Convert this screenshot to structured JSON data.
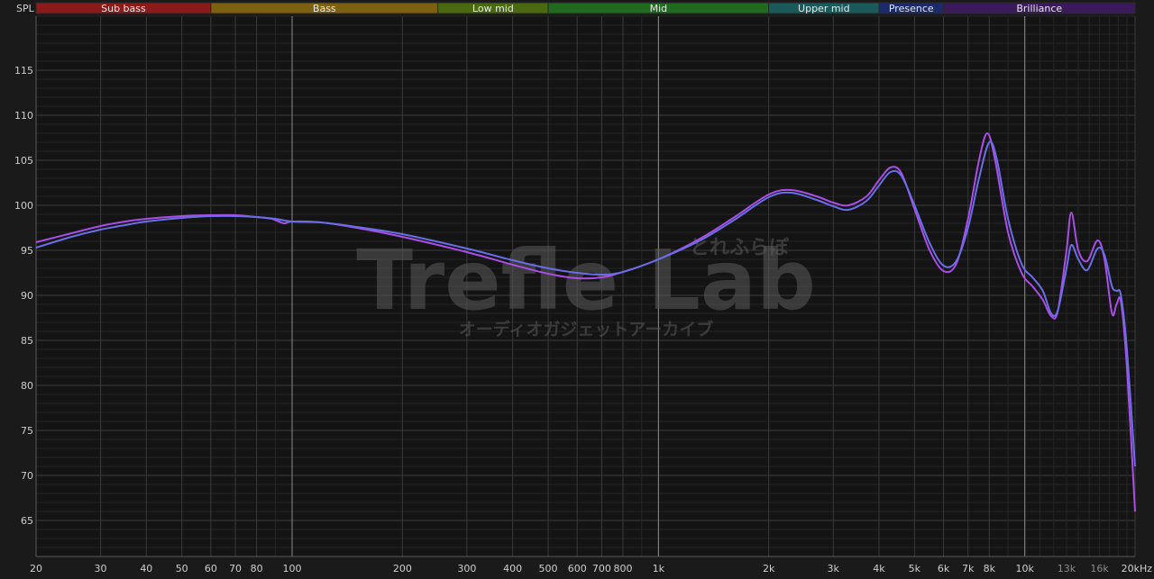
{
  "chart_data": {
    "type": "line",
    "ylabel": "SPL",
    "xscale": "log",
    "xlim": [
      20,
      20000
    ],
    "ylim": [
      61,
      121
    ],
    "yticks": [
      65,
      70,
      75,
      80,
      85,
      90,
      95,
      100,
      105,
      110,
      115
    ],
    "xticks": [
      {
        "v": 20,
        "label": "20"
      },
      {
        "v": 30,
        "label": "30"
      },
      {
        "v": 40,
        "label": "40"
      },
      {
        "v": 50,
        "label": "50"
      },
      {
        "v": 60,
        "label": "60"
      },
      {
        "v": 70,
        "label": "70"
      },
      {
        "v": 80,
        "label": "80"
      },
      {
        "v": 100,
        "label": "100"
      },
      {
        "v": 200,
        "label": "200"
      },
      {
        "v": 300,
        "label": "300"
      },
      {
        "v": 400,
        "label": "400"
      },
      {
        "v": 500,
        "label": "500"
      },
      {
        "v": 600,
        "label": "600"
      },
      {
        "v": 700,
        "label": "700"
      },
      {
        "v": 800,
        "label": "800"
      },
      {
        "v": 1000,
        "label": "1k"
      },
      {
        "v": 2000,
        "label": "2k"
      },
      {
        "v": 3000,
        "label": "3k"
      },
      {
        "v": 4000,
        "label": "4k"
      },
      {
        "v": 5000,
        "label": "5k"
      },
      {
        "v": 6000,
        "label": "6k"
      },
      {
        "v": 7000,
        "label": "7k"
      },
      {
        "v": 8000,
        "label": "8k"
      },
      {
        "v": 10000,
        "label": "10k"
      },
      {
        "v": 13000,
        "label": "13k",
        "dim": true
      },
      {
        "v": 16000,
        "label": "16k",
        "dim": true
      },
      {
        "v": 20000,
        "label": "20kHz"
      }
    ],
    "grid": true,
    "bands": [
      {
        "label": "Sub bass",
        "from": 20,
        "to": 60,
        "color": "#8b1a1a"
      },
      {
        "label": "Bass",
        "from": 60,
        "to": 250,
        "color": "#7d6010"
      },
      {
        "label": "Low mid",
        "from": 250,
        "to": 500,
        "color": "#4a6a10"
      },
      {
        "label": "Mid",
        "from": 500,
        "to": 2000,
        "color": "#1f6a1f"
      },
      {
        "label": "Upper mid",
        "from": 2000,
        "to": 4000,
        "color": "#1a5a5a"
      },
      {
        "label": "Presence",
        "from": 4000,
        "to": 6000,
        "color": "#1a2a6a"
      },
      {
        "label": "Brilliance",
        "from": 6000,
        "to": 20000,
        "color": "#3a1a5a"
      }
    ],
    "series": [
      {
        "color": "#a94ee6",
        "points": [
          [
            20,
            95.9
          ],
          [
            25,
            96.9
          ],
          [
            30,
            97.7
          ],
          [
            35,
            98.2
          ],
          [
            40,
            98.5
          ],
          [
            50,
            98.8
          ],
          [
            60,
            98.9
          ],
          [
            70,
            98.9
          ],
          [
            80,
            98.7
          ],
          [
            88,
            98.5
          ],
          [
            95,
            98.0
          ],
          [
            100,
            98.2
          ],
          [
            120,
            98.1
          ],
          [
            150,
            97.5
          ],
          [
            200,
            96.5
          ],
          [
            300,
            94.8
          ],
          [
            400,
            93.4
          ],
          [
            500,
            92.4
          ],
          [
            600,
            91.9
          ],
          [
            700,
            92.0
          ],
          [
            800,
            92.6
          ],
          [
            1000,
            94.0
          ],
          [
            1300,
            96.3
          ],
          [
            1600,
            98.6
          ],
          [
            2000,
            101.2
          ],
          [
            2300,
            101.7
          ],
          [
            2700,
            101.0
          ],
          [
            3000,
            100.3
          ],
          [
            3300,
            100.0
          ],
          [
            3700,
            101.0
          ],
          [
            4000,
            102.8
          ],
          [
            4300,
            104.2
          ],
          [
            4600,
            103.6
          ],
          [
            5000,
            99.6
          ],
          [
            5500,
            95.0
          ],
          [
            6000,
            92.7
          ],
          [
            6500,
            93.5
          ],
          [
            7000,
            98.5
          ],
          [
            7500,
            105.0
          ],
          [
            7900,
            108.0
          ],
          [
            8300,
            105.0
          ],
          [
            9000,
            97.0
          ],
          [
            9800,
            92.5
          ],
          [
            10500,
            91.0
          ],
          [
            11200,
            89.5
          ],
          [
            11800,
            87.7
          ],
          [
            12300,
            88.2
          ],
          [
            13000,
            95.0
          ],
          [
            13400,
            99.2
          ],
          [
            14000,
            95.0
          ],
          [
            14800,
            93.8
          ],
          [
            15800,
            96.1
          ],
          [
            16500,
            94.0
          ],
          [
            17300,
            88.0
          ],
          [
            17800,
            89.0
          ],
          [
            18300,
            89.3
          ],
          [
            19000,
            82.0
          ],
          [
            20000,
            66.0
          ]
        ]
      },
      {
        "color": "#6a6ee6",
        "points": [
          [
            20,
            95.3
          ],
          [
            25,
            96.5
          ],
          [
            30,
            97.3
          ],
          [
            35,
            97.8
          ],
          [
            40,
            98.2
          ],
          [
            50,
            98.6
          ],
          [
            60,
            98.8
          ],
          [
            70,
            98.8
          ],
          [
            80,
            98.7
          ],
          [
            90,
            98.5
          ],
          [
            100,
            98.2
          ],
          [
            120,
            98.1
          ],
          [
            150,
            97.6
          ],
          [
            200,
            96.8
          ],
          [
            300,
            95.2
          ],
          [
            400,
            93.9
          ],
          [
            500,
            93.0
          ],
          [
            600,
            92.5
          ],
          [
            700,
            92.3
          ],
          [
            800,
            92.6
          ],
          [
            1000,
            94.0
          ],
          [
            1300,
            96.1
          ],
          [
            1600,
            98.3
          ],
          [
            2000,
            100.9
          ],
          [
            2300,
            101.4
          ],
          [
            2700,
            100.6
          ],
          [
            3000,
            99.9
          ],
          [
            3300,
            99.5
          ],
          [
            3700,
            100.5
          ],
          [
            4000,
            102.2
          ],
          [
            4300,
            103.7
          ],
          [
            4600,
            103.3
          ],
          [
            5000,
            100.0
          ],
          [
            5500,
            95.8
          ],
          [
            6000,
            93.3
          ],
          [
            6500,
            93.8
          ],
          [
            7000,
            97.5
          ],
          [
            7500,
            103.0
          ],
          [
            8000,
            107.0
          ],
          [
            8400,
            105.0
          ],
          [
            9000,
            98.5
          ],
          [
            9800,
            93.5
          ],
          [
            10500,
            92.0
          ],
          [
            11200,
            90.5
          ],
          [
            11800,
            88.0
          ],
          [
            12300,
            88.3
          ],
          [
            13000,
            93.0
          ],
          [
            13400,
            95.6
          ],
          [
            14000,
            94.0
          ],
          [
            14800,
            92.8
          ],
          [
            15800,
            95.2
          ],
          [
            16500,
            94.5
          ],
          [
            17300,
            91.0
          ],
          [
            17800,
            90.5
          ],
          [
            18300,
            90.0
          ],
          [
            19000,
            84.0
          ],
          [
            20000,
            71.0
          ]
        ]
      }
    ]
  },
  "watermark": {
    "text": "Trefle Lab",
    "kana_top": "とれふらぼ",
    "kana_sub": "オーディオガジェットアーカイブ"
  }
}
